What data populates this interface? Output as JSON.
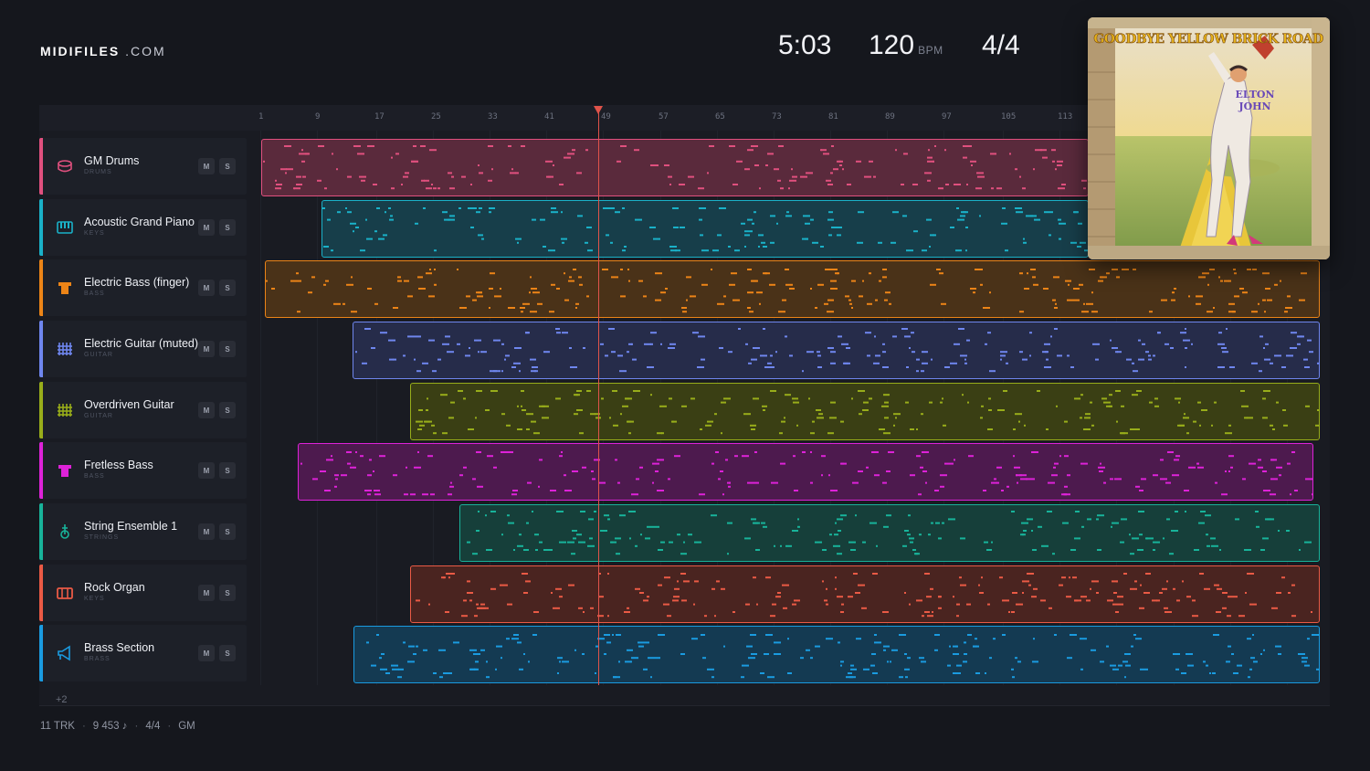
{
  "brand": {
    "name_bold": "MIDIFILES",
    "name_suffix": ".COM"
  },
  "stats": {
    "duration": "5:03",
    "tempo": "120",
    "tempo_unit": "BPM",
    "time_signature": "4/4"
  },
  "ruler_ticks": [
    "1",
    "9",
    "17",
    "25",
    "33",
    "41",
    "49",
    "57",
    "65",
    "73",
    "81",
    "89",
    "97",
    "105",
    "113"
  ],
  "tracks": [
    {
      "name": "GM Drums",
      "category": "DRUMS",
      "icon": "drum-icon",
      "color": "#e0507e",
      "clip_start": 1,
      "clip_end": 1500,
      "rest": "#5a2a3c"
    },
    {
      "name": "Acoustic Grand Piano",
      "category": "KEYS",
      "icon": "piano-icon",
      "color": "#1ab1c8",
      "clip_start": 9,
      "clip_end": 1500,
      "rest": "#173e4a"
    },
    {
      "name": "Electric Bass (finger)",
      "category": "BASS",
      "icon": "bass-icon",
      "color": "#ec8417",
      "clip_start": 1,
      "clip_end": 1500,
      "rest": "#4a3218"
    },
    {
      "name": "Electric Guitar (muted)",
      "category": "GUITAR",
      "icon": "guitar-grid-icon",
      "color": "#6f86ee",
      "clip_start": 14,
      "clip_end": 1500,
      "rest": "#262c4a"
    },
    {
      "name": "Overdriven Guitar",
      "category": "GUITAR",
      "icon": "guitar-grid-icon",
      "color": "#98ad1a",
      "clip_start": 22,
      "clip_end": 1500,
      "rest": "#3a3f14"
    },
    {
      "name": "Fretless Bass",
      "category": "BASS",
      "icon": "bass-icon",
      "color": "#dd22d8",
      "clip_start": 6,
      "clip_end": 1500,
      "rest": "#4d1a4e"
    },
    {
      "name": "String Ensemble 1",
      "category": "STRINGS",
      "icon": "strings-icon",
      "color": "#18b39a",
      "clip_start": 29,
      "clip_end": 1500,
      "rest": "#163f3a"
    },
    {
      "name": "Rock Organ",
      "category": "KEYS",
      "icon": "organ-icon",
      "color": "#ea5a45",
      "clip_start": 22,
      "clip_end": 1500,
      "rest": "#4a2420"
    },
    {
      "name": "Brass Section",
      "category": "BRASS",
      "icon": "brass-icon",
      "color": "#1a9be0",
      "clip_start": 14,
      "clip_end": 1500,
      "rest": "#143a52"
    }
  ],
  "buttons": {
    "mute": "M",
    "solo": "S"
  },
  "more_tracks": "+2",
  "footer": {
    "tracks": "11 TRK",
    "notes": "9 453 ♪",
    "meter": "4/4",
    "standard": "GM"
  },
  "cover": {
    "title": "GOODBYE YELLOW BRICK ROAD",
    "artist_line1": "ELTON",
    "artist_line2": "JOHN"
  }
}
